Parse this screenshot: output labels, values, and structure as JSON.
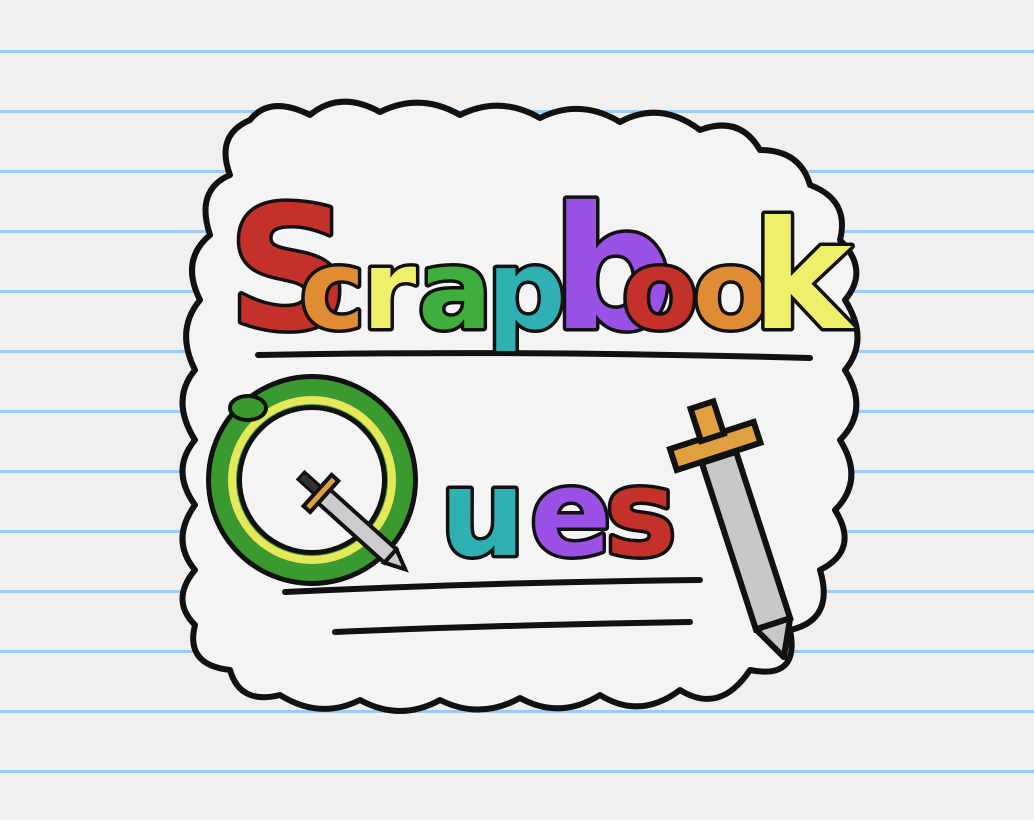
{
  "title": {
    "line1": "Scrapbook",
    "line2": "Quest",
    "line1_colors": [
      "#c4302a",
      "#e08c35",
      "#eef06a",
      "#3fae3f",
      "#2fb0b3",
      "#9a52e6",
      "#c4302a",
      "#e08c35",
      "#eef06a"
    ],
    "line2_colors": [
      "#3a9a30",
      "#2fb0b3",
      "#9a52e6",
      "#c4302a",
      "#aaaaaa"
    ]
  },
  "colors": {
    "paper": "#f0f0f0",
    "rule_line": "#9ccaf2",
    "outline": "#111111",
    "snake_green": "#3a9a30",
    "snake_yellow": "#e6e85a",
    "sword_blade": "#c8c8c8",
    "sword_hilt": "#e0a040"
  }
}
